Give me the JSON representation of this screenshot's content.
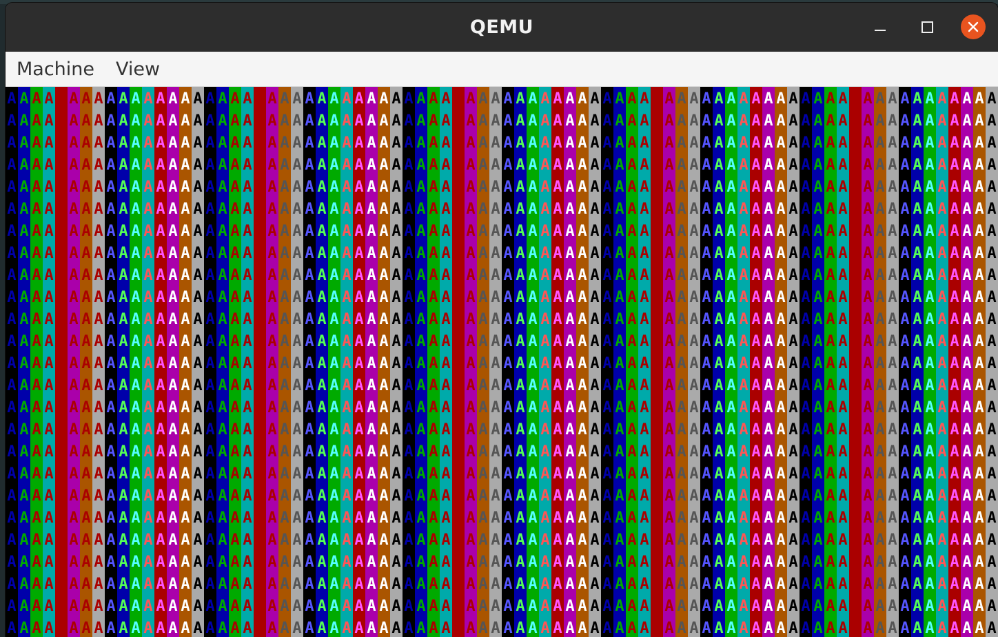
{
  "window": {
    "title": "QEMU"
  },
  "window_controls": {
    "minimize_icon": "minimize-icon",
    "maximize_icon": "maximize-icon",
    "close_icon": "close-icon",
    "close_color": "#e9541f"
  },
  "menubar": {
    "items": [
      {
        "label": "Machine"
      },
      {
        "label": "View"
      }
    ]
  },
  "vga_screen": {
    "glyph": "A",
    "rows": 25,
    "columns": 80,
    "palette": [
      "#000000",
      "#0000aa",
      "#00aa00",
      "#00aaaa",
      "#aa0000",
      "#aa00aa",
      "#aa5500",
      "#aaaaaa",
      "#555555",
      "#5555ff",
      "#55ff55",
      "#55ffff",
      "#ff5555",
      "#ff55ff",
      "#ffff55",
      "#ffffff"
    ],
    "column_background_index": [
      0,
      1,
      2,
      3,
      4,
      5,
      6,
      7,
      0,
      1,
      2,
      3,
      4,
      5,
      6,
      7,
      0,
      1,
      2,
      3,
      4,
      5,
      6,
      7,
      0,
      1,
      2,
      3,
      4,
      5,
      6,
      7,
      0,
      1,
      2,
      3,
      4,
      5,
      6,
      7,
      0,
      1,
      2,
      3,
      4,
      5,
      6,
      7,
      0,
      1,
      2,
      3,
      4,
      5,
      6,
      7,
      0,
      1,
      2,
      3,
      4,
      5,
      6,
      7,
      0,
      1,
      2,
      3,
      4,
      5,
      6,
      7,
      0,
      1,
      2,
      3,
      4,
      5,
      6,
      7
    ],
    "column_foreground_index": [
      1,
      2,
      4,
      4,
      4,
      4,
      4,
      4,
      9,
      10,
      11,
      12,
      13,
      15,
      15,
      0,
      1,
      2,
      4,
      4,
      4,
      4,
      8,
      8,
      9,
      10,
      11,
      12,
      13,
      15,
      15,
      0,
      1,
      2,
      4,
      4,
      4,
      4,
      8,
      8,
      9,
      10,
      11,
      12,
      13,
      15,
      15,
      0,
      1,
      2,
      4,
      4,
      4,
      4,
      8,
      8,
      9,
      10,
      11,
      12,
      13,
      15,
      15,
      0,
      1,
      2,
      4,
      4,
      4,
      4,
      8,
      8,
      9,
      10,
      11,
      12,
      13,
      15,
      15,
      0
    ]
  }
}
